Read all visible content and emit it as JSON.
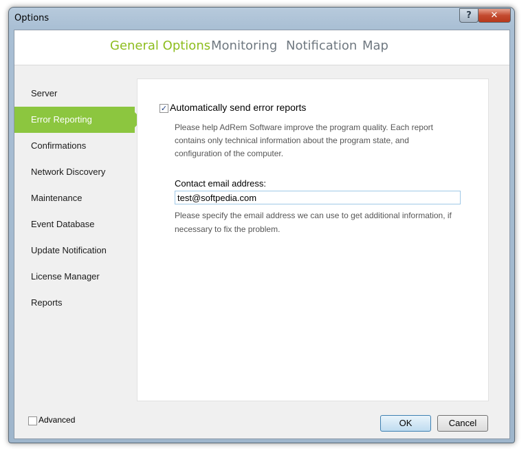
{
  "window": {
    "title": "Options",
    "help_glyph": "?",
    "close_glyph": "✕"
  },
  "tabs": [
    {
      "label": "General Options",
      "active": true
    },
    {
      "label": "Monitoring",
      "active": false
    },
    {
      "label": "Notification",
      "active": false
    },
    {
      "label": "Map",
      "active": false
    }
  ],
  "sidebar": {
    "items": [
      {
        "label": "Server",
        "selected": false
      },
      {
        "label": "Error Reporting",
        "selected": true
      },
      {
        "label": "Confirmations",
        "selected": false
      },
      {
        "label": "Network Discovery",
        "selected": false
      },
      {
        "label": "Maintenance",
        "selected": false
      },
      {
        "label": "Event Database",
        "selected": false
      },
      {
        "label": "Update Notification",
        "selected": false
      },
      {
        "label": "License Manager",
        "selected": false
      },
      {
        "label": "Reports",
        "selected": false
      }
    ]
  },
  "panel": {
    "auto_send_label": "Automatically send error reports",
    "auto_send_checked": true,
    "description_lines": [
      "Please help AdRem Software improve the program quality. Each report",
      "contains only technical information about the program state, and",
      "configuration of the computer."
    ],
    "email_label": "Contact email address:",
    "email_value": "test@softpedia.com",
    "email_help_lines": [
      "Please specify the email address we can use to get additional information, if",
      "necessary to fix the problem."
    ]
  },
  "footer": {
    "advanced_label": "Advanced",
    "advanced_checked": false,
    "ok_label": "OK",
    "cancel_label": "Cancel"
  },
  "colors": {
    "accent": "#8cc63f",
    "tab_active": "#8dbd1e",
    "tab_inactive": "#6f7880"
  }
}
